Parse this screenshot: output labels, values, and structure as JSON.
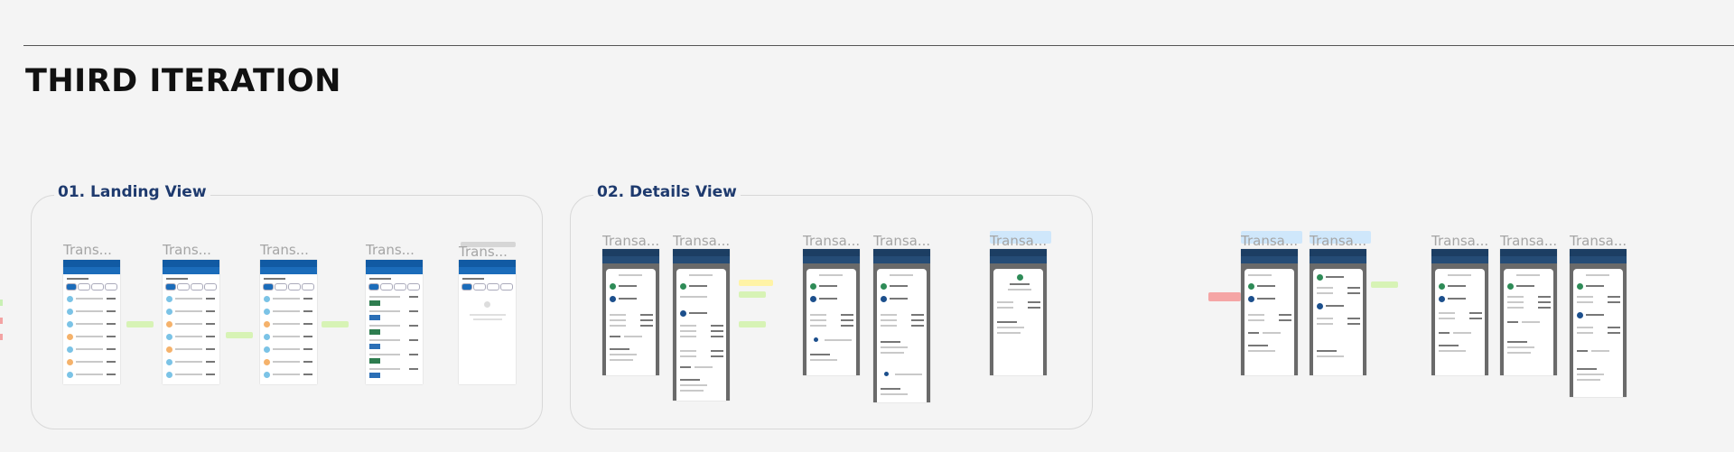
{
  "page": {
    "title": "THIRD ITERATION",
    "accent_color": "#1e3a6e"
  },
  "sections": [
    {
      "label": "01. Landing View"
    },
    {
      "label": "02. Details View"
    }
  ],
  "frame_labels": {
    "landing": [
      "Trans...",
      "Trans...",
      "Trans...",
      "Trans...",
      "Trans..."
    ],
    "details": [
      "Transa...",
      "Transa...",
      "Transa...",
      "Transa...",
      "Transa..."
    ],
    "extra": [
      "Transa...",
      "Transa...",
      "Transa...",
      "Transa...",
      "Transa..."
    ]
  }
}
